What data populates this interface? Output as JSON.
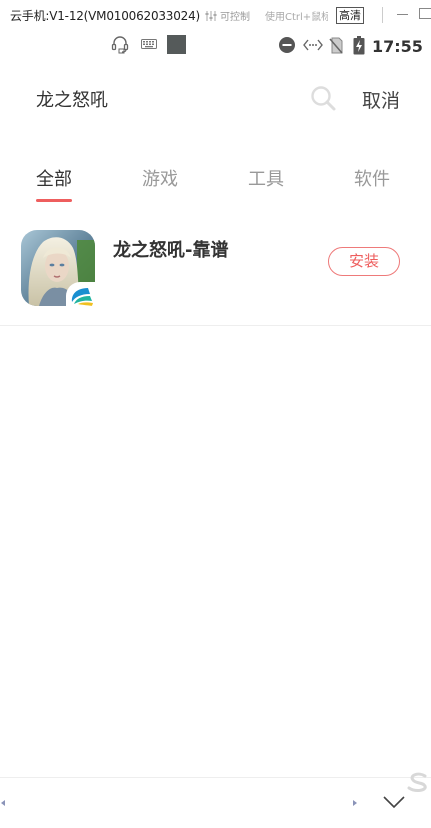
{
  "window": {
    "title": "云手机:V1-12(VM010062033024)",
    "control_label": "可控制",
    "control_icon": "sliders-icon",
    "hint": "使用Ctrl+鼠标",
    "quality": "高清"
  },
  "status_bar": {
    "time": "17:55",
    "icons": [
      "headset-icon",
      "keyboard-icon",
      "square-icon",
      "do-not-disturb-icon",
      "data-transfer-icon",
      "no-sim-icon",
      "battery-charging-icon"
    ]
  },
  "search": {
    "query": "龙之怒吼",
    "icon": "search-icon",
    "cancel_label": "取消"
  },
  "tabs": [
    {
      "label": "全部",
      "active": true
    },
    {
      "label": "游戏",
      "active": false
    },
    {
      "label": "工具",
      "active": false
    },
    {
      "label": "软件",
      "active": false
    }
  ],
  "results": [
    {
      "name": "龙之怒吼-靠谱",
      "icon": "game-avatar-icon",
      "badge_icon": "platform-badge-icon",
      "action_label": "安装"
    }
  ],
  "colors": {
    "accent": "#ee5e5e",
    "text_primary": "#333333",
    "text_secondary": "#999999"
  }
}
